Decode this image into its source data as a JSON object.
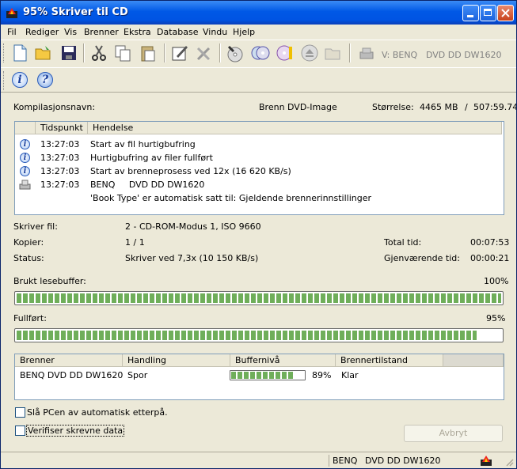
{
  "window": {
    "title": "95% Skriver til CD"
  },
  "menu": [
    "Fil",
    "Rediger",
    "Vis",
    "Brenner",
    "Ekstra",
    "Database",
    "Vindu",
    "Hjelp"
  ],
  "toolbar": {
    "drive_label": "V: BENQ",
    "drive_model": "DVD DD DW1620"
  },
  "summary": {
    "compilation_label": "Kompilasjonsnavn:",
    "compilation_value": "Brenn DVD-Image",
    "size_label": "Størrelse:",
    "size_mb": "4465 MB",
    "size_time": "507:59.74"
  },
  "log": {
    "col_time": "Tidspunkt",
    "col_event": "Hendelse",
    "rows": [
      {
        "time": "13:27:03",
        "event": "Start av fil hurtigbufring"
      },
      {
        "time": "13:27:03",
        "event": "Hurtigbufring av filer fullført"
      },
      {
        "time": "13:27:03",
        "event": "Start av brenneprosess ved 12x (16 620 KB/s)"
      },
      {
        "time": "13:27:03",
        "event": "BENQ     DVD DD DW1620"
      }
    ],
    "note": "'Book Type' er automatisk satt til: Gjeldende brennerinnstillinger"
  },
  "details": {
    "writing_label": "Skriver fil:",
    "writing_value": "2 - CD-ROM-Modus 1, ISO 9660",
    "copies_label": "Kopier:",
    "copies_value": "1 / 1",
    "status_label": "Status:",
    "status_value": "Skriver ved 7,3x (10 150 KB/s)",
    "total_label": "Total tid:",
    "total_value": "00:07:53",
    "remaining_label": "Gjenværende tid:",
    "remaining_value": "00:00:21"
  },
  "buffer": {
    "label": "Brukt lesebuffer:",
    "percent_text": "100%",
    "fraction": 1.0
  },
  "completed": {
    "label": "Fullført:",
    "percent_text": "95%",
    "fraction": 0.95
  },
  "recorders": {
    "col_burner": "Brenner",
    "col_action": "Handling",
    "col_buffer": "Buffernivå",
    "col_state": "Brennertilstand",
    "rows": [
      {
        "burner": "BENQ DVD DD DW1620",
        "action": "Spor",
        "buffer_text": "89%",
        "buffer_fraction": 0.89,
        "state": "Klar"
      }
    ]
  },
  "options": {
    "shutdown_label": "Slå PCen av automatisk etterpå.",
    "verify_label": "Verifiser skrevne data"
  },
  "buttons": {
    "cancel": "Avbryt"
  },
  "statusbar": {
    "drive": "BENQ",
    "model": "DVD DD DW1620"
  }
}
